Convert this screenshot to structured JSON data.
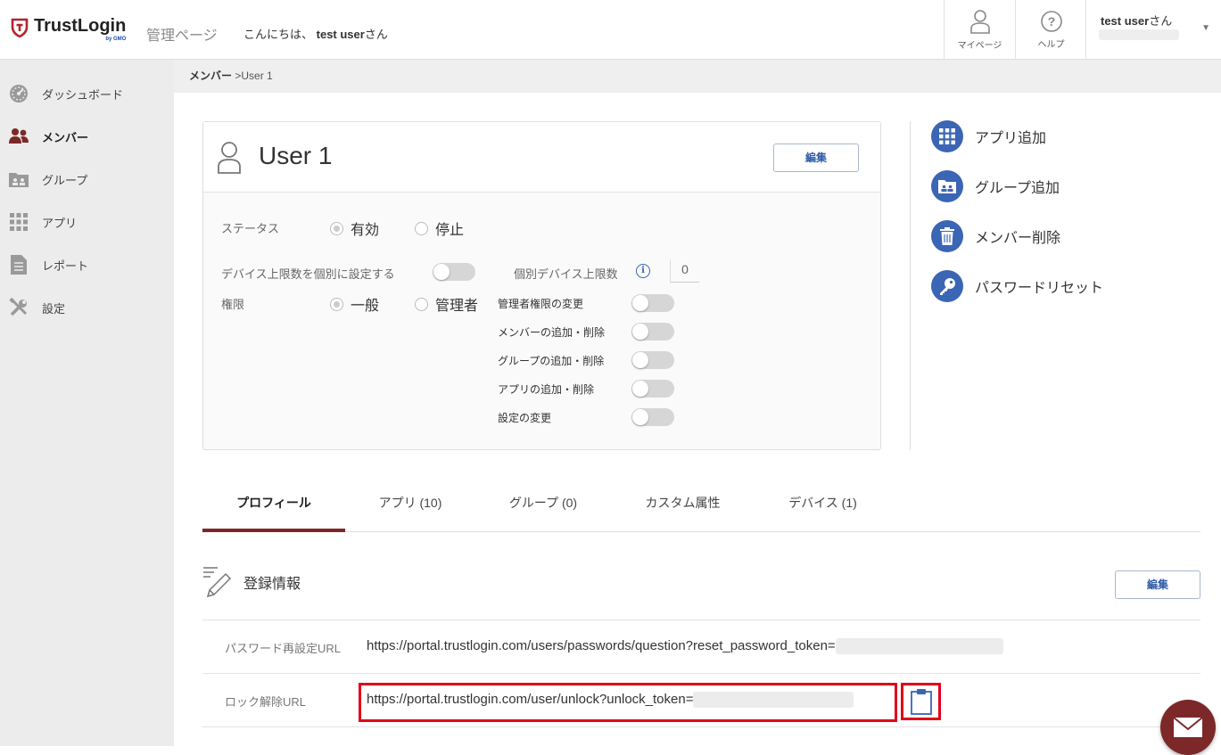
{
  "header": {
    "brand": "TrustLogin",
    "brand_sub": "by GMO",
    "admin_page": "管理ページ",
    "greeting_prefix": "こんにちは、",
    "greeting_user": "test user",
    "greeting_suffix": "さん",
    "mypage_label": "マイページ",
    "help_label": "ヘルプ",
    "user_name": "test user",
    "user_suffix": "さん"
  },
  "sidebar": {
    "items": [
      {
        "label": "ダッシュボード",
        "icon": "dashboard-icon"
      },
      {
        "label": "メンバー",
        "icon": "members-icon",
        "active": true
      },
      {
        "label": "グループ",
        "icon": "group-icon"
      },
      {
        "label": "アプリ",
        "icon": "apps-icon"
      },
      {
        "label": "レポート",
        "icon": "report-icon"
      },
      {
        "label": "設定",
        "icon": "settings-icon"
      }
    ]
  },
  "breadcrumb": {
    "parent": "メンバー",
    "separator": " >",
    "current": "User 1"
  },
  "card": {
    "user_name": "User 1",
    "edit_label": "編集",
    "status_label": "ステータス",
    "status_active": "有効",
    "status_stopped": "停止",
    "device_limit_label": "デバイス上限数を個別に設定する",
    "individual_limit_label": "個別デバイス上限数",
    "individual_limit_value": "0",
    "role_label": "権限",
    "role_general": "一般",
    "role_admin": "管理者",
    "permissions": [
      "管理者権限の変更",
      "メンバーの追加・削除",
      "グループの追加・削除",
      "アプリの追加・削除",
      "設定の変更"
    ]
  },
  "actions": [
    {
      "label": "アプリ追加",
      "icon": "app-grid-icon"
    },
    {
      "label": "グループ追加",
      "icon": "group-folder-icon"
    },
    {
      "label": "メンバー削除",
      "icon": "trash-icon"
    },
    {
      "label": "パスワードリセット",
      "icon": "key-icon"
    }
  ],
  "tabs": [
    {
      "label": "プロフィール",
      "active": true
    },
    {
      "label": "アプリ (10)"
    },
    {
      "label": "グループ (0)"
    },
    {
      "label": "カスタム属性"
    },
    {
      "label": "デバイス (1)"
    }
  ],
  "registration": {
    "title": "登録情報",
    "edit_label": "編集",
    "fields": [
      {
        "label": "パスワード再設定URL",
        "value": "https://portal.trustlogin.com/users/passwords/question?reset_password_token="
      },
      {
        "label": "ロック解除URL",
        "value": "https://portal.trustlogin.com/user/unlock?unlock_token="
      }
    ]
  },
  "colors": {
    "accent": "#7d2828",
    "action_blue": "#3b65b5",
    "highlight": "#e2001a"
  }
}
